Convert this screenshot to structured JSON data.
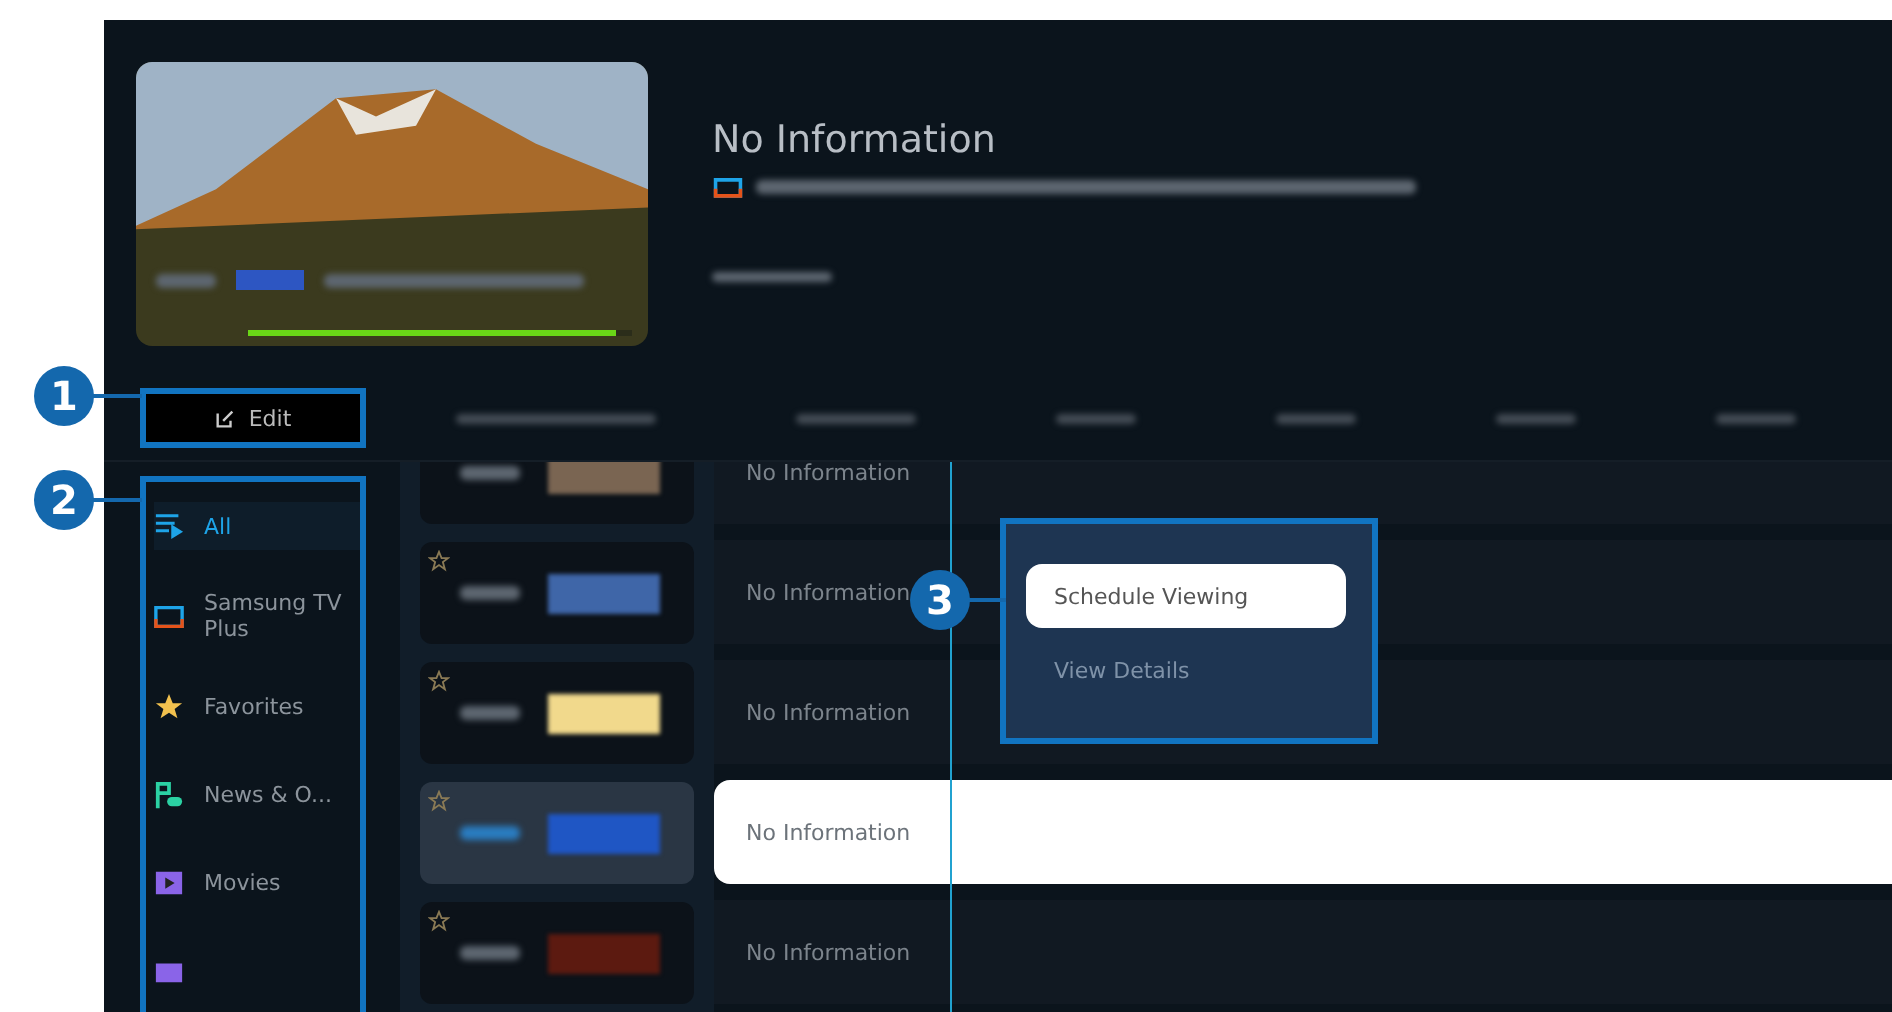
{
  "preview": {
    "progress": {
      "level": 0.96
    }
  },
  "program_info": {
    "title": "No Information"
  },
  "edit_button": {
    "label": "Edit"
  },
  "sidebar": {
    "items": [
      {
        "kind": "list",
        "label": "All",
        "selected": true
      },
      {
        "kind": "tv",
        "label": "Samsung TV Plus",
        "selected": false
      },
      {
        "kind": "star",
        "label": "Favorites",
        "selected": false
      },
      {
        "kind": "news",
        "label": "News & O...",
        "selected": false
      },
      {
        "kind": "movie",
        "label": "Movies",
        "selected": false
      },
      {
        "kind": "video",
        "selected": false
      }
    ]
  },
  "channels": [
    {
      "color": "#7a6552",
      "selected": false
    },
    {
      "color": "#3f66a8",
      "selected": false
    },
    {
      "color": "#f1d98c",
      "selected": false
    },
    {
      "color": "#1f56c4",
      "selected": true
    },
    {
      "color": "#5c1a10",
      "selected": false
    }
  ],
  "programs": [
    {
      "title": "No Information",
      "selected": false
    },
    {
      "title": "No Information",
      "selected": false
    },
    {
      "title": "No Information",
      "selected": false
    },
    {
      "title": "No Information",
      "selected": true
    },
    {
      "title": "No Information",
      "selected": false
    }
  ],
  "popup": {
    "options": [
      {
        "label": "Schedule Viewing",
        "selected": true
      },
      {
        "label": "View Details",
        "selected": false
      }
    ]
  },
  "callouts": [
    {
      "number": "1",
      "kind": "edit"
    },
    {
      "number": "2",
      "kind": "sidebar"
    },
    {
      "number": "3",
      "kind": "popup"
    }
  ]
}
